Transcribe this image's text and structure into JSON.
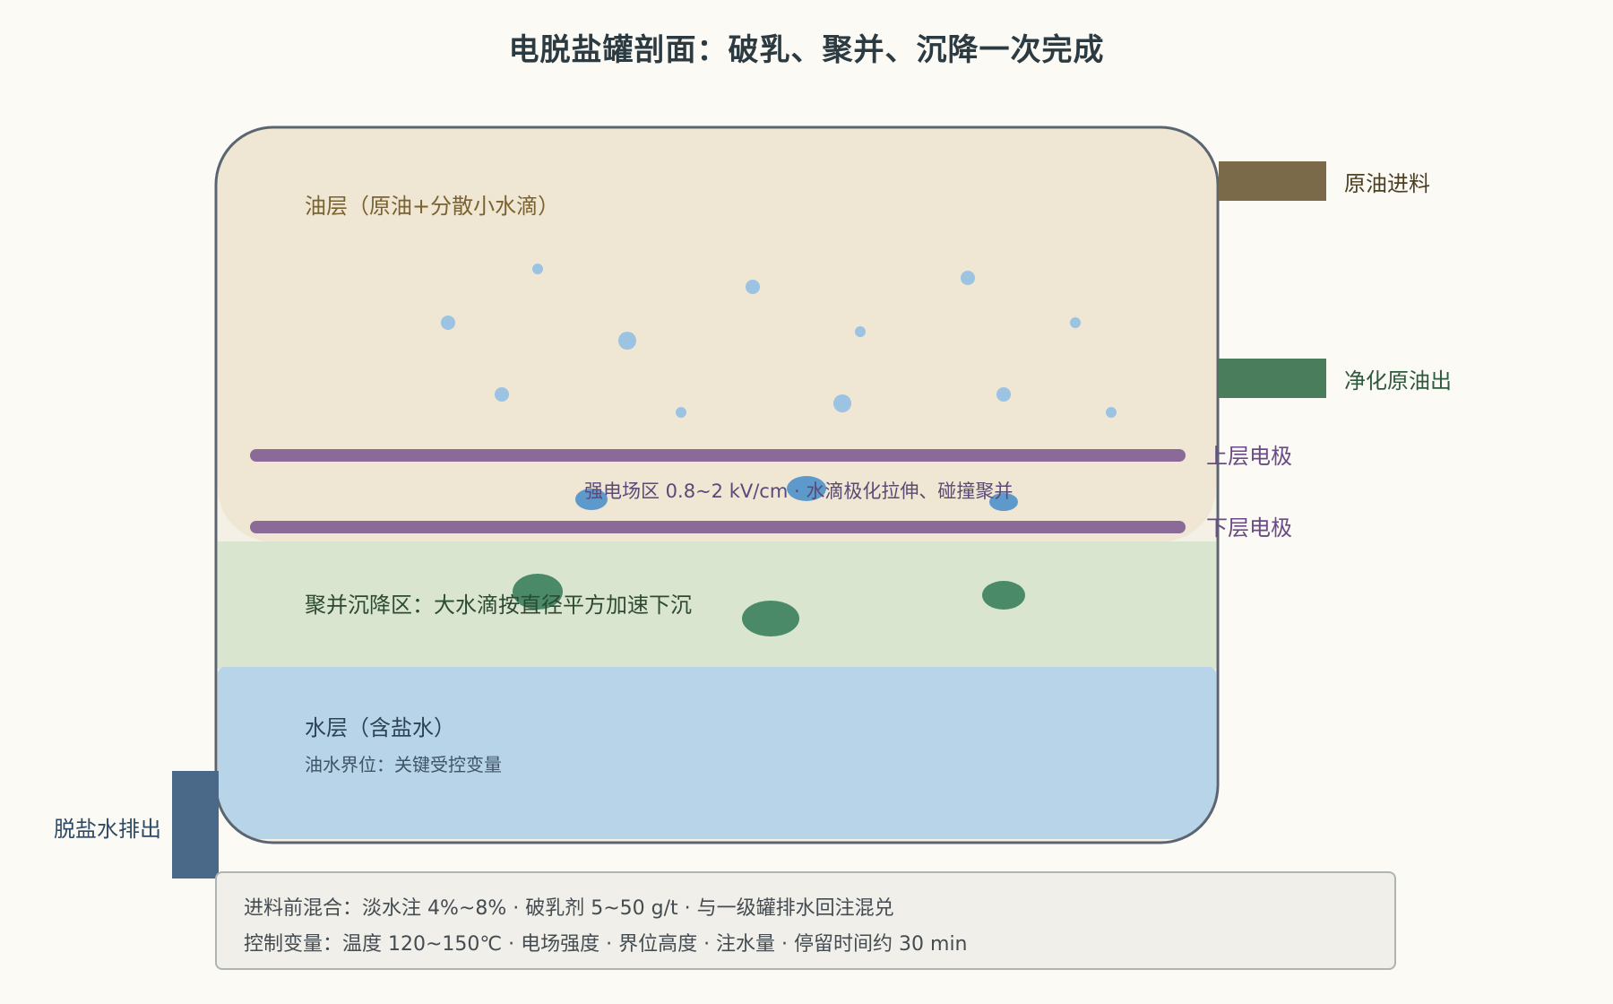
{
  "title": "电脱盐罐剖面：破乳、聚并、沉降一次完成",
  "zones": {
    "oil_layer": "油层（原油+分散小水滴）",
    "field_zone": "强电场区 0.8~2 kV/cm · 水滴极化拉伸、碰撞聚并",
    "coalescence_zone": "聚并沉降区：大水滴按直径平方加速下沉",
    "water_layer": "水层（含盐水）",
    "interface": "油水界位：关键受控变量"
  },
  "ports": {
    "crude_feed": "原油进料",
    "clean_crude_out": "净化原油出",
    "brine_drain": "脱盐水排出"
  },
  "electrodes": {
    "upper": "上层电极",
    "lower": "下层电极"
  },
  "notes": {
    "premix": "进料前混合：淡水注 4%~8% · 破乳剂 5~50 g/t · 与一级罐排水回注混兑",
    "control": "控制变量：温度 120~150℃ · 电场强度 · 界位高度 · 注水量 · 停留时间约 30 min"
  },
  "colors": {
    "oil": "#efe6d3",
    "coalescence": "#dae5cf",
    "water": "#b8d4e8",
    "electrode": "#8a6a96",
    "feed_pipe": "#7b6a4a",
    "clean_pipe": "#4a7d5b",
    "drain_pipe": "#4a6888",
    "small_droplet": "#9cc3e2",
    "medium_droplet": "#5d9acb",
    "large_droplet": "#4a8a68"
  }
}
